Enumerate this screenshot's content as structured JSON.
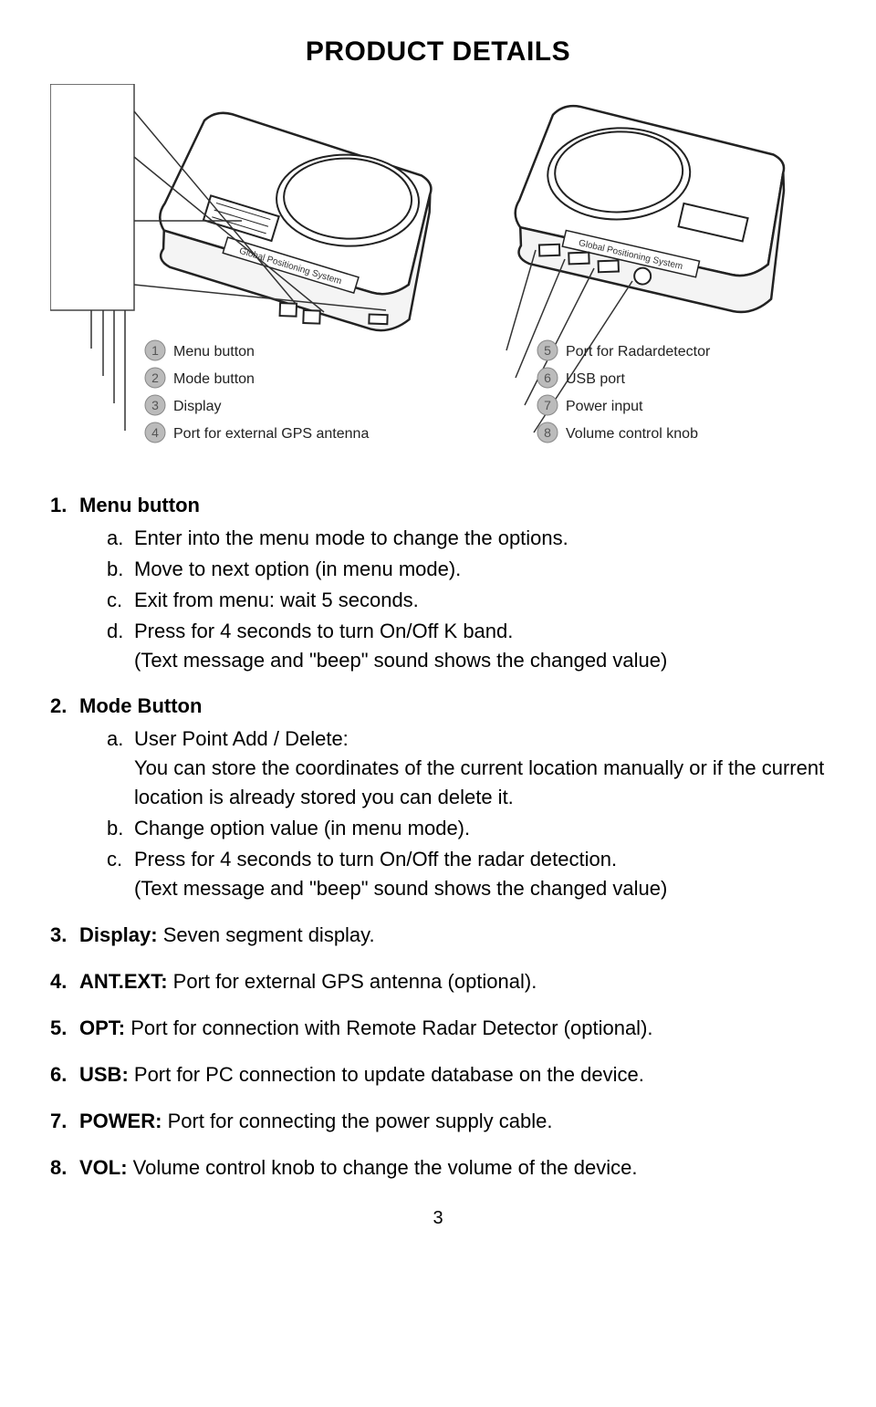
{
  "title": "PRODUCT DETAILS",
  "page_number": "3",
  "diagram": {
    "device_label": "Global Positioning System",
    "left_callouts": [
      {
        "n": "1",
        "label": "Menu button"
      },
      {
        "n": "2",
        "label": "Mode button"
      },
      {
        "n": "3",
        "label": "Display"
      },
      {
        "n": "4",
        "label": "Port for external GPS antenna"
      }
    ],
    "right_callouts": [
      {
        "n": "5",
        "label": "Port for Radardetector"
      },
      {
        "n": "6",
        "label": "USB port"
      },
      {
        "n": "7",
        "label": "Power input"
      },
      {
        "n": "8",
        "label": "Volume control knob"
      }
    ]
  },
  "items": [
    {
      "head": "Menu button",
      "desc": "",
      "subs": [
        {
          "text": "Enter into the menu mode to change the options."
        },
        {
          "text": "Move to next option (in menu mode)."
        },
        {
          "text": "Exit from menu: wait 5 seconds."
        },
        {
          "text": "Press for 4 seconds to turn On/Off K band.",
          "note": "(Text message and \"beep\" sound shows the changed value)"
        }
      ]
    },
    {
      "head": "Mode Button",
      "desc": "",
      "subs": [
        {
          "text": "User Point Add / Delete:",
          "note": "You can store the coordinates of the current location manually or if the current location is already stored you can delete it."
        },
        {
          "text": "Change option value (in menu mode)."
        },
        {
          "text": "Press for 4 seconds to turn On/Off the radar detection.",
          "note": "(Text message and \"beep\" sound shows the changed value)"
        }
      ]
    },
    {
      "head": "Display:",
      "desc": " Seven segment display."
    },
    {
      "head": "ANT.EXT:",
      "desc": " Port for external GPS antenna (optional)."
    },
    {
      "head": "OPT:",
      "desc": " Port for connection with Remote Radar Detector (optional)."
    },
    {
      "head": "USB:",
      "desc": " Port for PC connection to update database on the device."
    },
    {
      "head": "POWER:",
      "desc": " Port for connecting the power supply cable."
    },
    {
      "head": "VOL:",
      "desc": " Volume control knob to change the volume of the device."
    }
  ]
}
